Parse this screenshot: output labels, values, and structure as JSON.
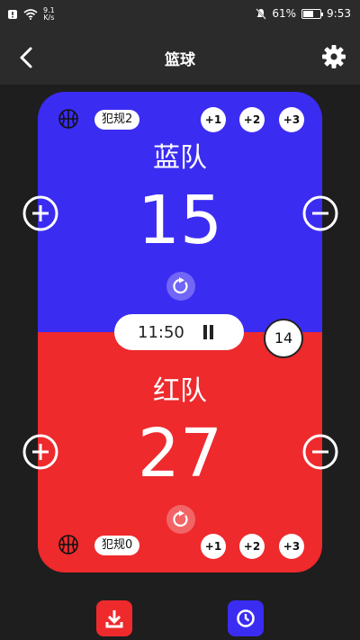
{
  "status": {
    "speed_value": "9.1",
    "speed_unit": "K/s",
    "battery": "61%",
    "time": "9:53",
    "battery_level": 0.61
  },
  "header": {
    "title": "篮球"
  },
  "timer": {
    "time": "11:50",
    "shot_clock": "14"
  },
  "team_top": {
    "name": "蓝队",
    "score": "15",
    "fouls": "犯规2",
    "color": "#3b2cf2"
  },
  "team_bottom": {
    "name": "红队",
    "score": "27",
    "fouls": "犯规0",
    "color": "#ee2a2d"
  },
  "points": {
    "p1": "+1",
    "p2": "+2",
    "p3": "+3"
  },
  "colors": {
    "background": "#1e1e1e",
    "bar": "#2b2b2b",
    "download_button": "#ee2a2d",
    "history_button": "#3b2cf2"
  }
}
